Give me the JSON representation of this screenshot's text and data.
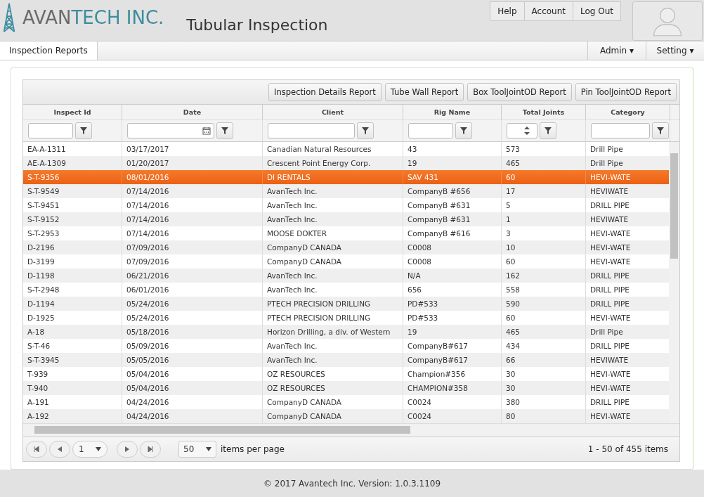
{
  "header": {
    "logo_dark": "AVAN",
    "logo_accent": "TECH INC.",
    "title": "Tubular Inspection",
    "links": [
      "Help",
      "Account",
      "Log Out"
    ]
  },
  "nav": {
    "tabs": [
      {
        "label": "Inspection Reports",
        "selected": true
      }
    ],
    "menus": [
      "Admin ▾",
      "Setting ▾"
    ]
  },
  "toolbar": [
    "Inspection Details Report",
    "Tube Wall Report",
    "Box ToolJointOD Report",
    "Pin ToolJointOD Report"
  ],
  "table": {
    "columns": [
      {
        "label": "Inspect Id",
        "kind": "text"
      },
      {
        "label": "Date",
        "kind": "date"
      },
      {
        "label": "Client",
        "kind": "text"
      },
      {
        "label": "Rig Name",
        "kind": "text"
      },
      {
        "label": "Total Joints",
        "kind": "numeric"
      },
      {
        "label": "Category",
        "kind": "text"
      }
    ],
    "rows": [
      {
        "cells": [
          "EA-A-1311",
          "03/17/2017",
          "Canadian Natural Resources",
          "43",
          "573",
          "Drill Pipe"
        ],
        "selected": false
      },
      {
        "cells": [
          "AE-A-1309",
          "01/20/2017",
          "Crescent Point Energy Corp.",
          "19",
          "465",
          "Drill Pipe"
        ],
        "selected": false
      },
      {
        "cells": [
          "S-T-9356",
          "08/01/2016",
          "DI RENTALS",
          "SAV 431",
          "60",
          "HEVI-WATE"
        ],
        "selected": true
      },
      {
        "cells": [
          "S-T-9549",
          "07/14/2016",
          "AvanTech Inc.",
          "CompanyB #656",
          "17",
          "HEVIWATE"
        ],
        "selected": false
      },
      {
        "cells": [
          "S-T-9451",
          "07/14/2016",
          "AvanTech Inc.",
          "CompanyB #631",
          "5",
          "DRILL PIPE"
        ],
        "selected": false
      },
      {
        "cells": [
          "S-T-9152",
          "07/14/2016",
          "AvanTech Inc.",
          "CompanyB #631",
          "1",
          "HEVIWATE"
        ],
        "selected": false
      },
      {
        "cells": [
          "S-T-2953",
          "07/14/2016",
          "MOOSE DOKTER",
          "CompanyB #616",
          "3",
          "HEVI-WATE"
        ],
        "selected": false
      },
      {
        "cells": [
          "D-2196",
          "07/09/2016",
          "CompanyD CANADA",
          "C0008",
          "10",
          "HEVI-WATE"
        ],
        "selected": false
      },
      {
        "cells": [
          "D-3199",
          "07/09/2016",
          "CompanyD CANADA",
          "C0008",
          "60",
          "HEVI-WATE"
        ],
        "selected": false
      },
      {
        "cells": [
          "D-1198",
          "06/21/2016",
          "AvanTech Inc.",
          "N/A",
          "162",
          "DRILL PIPE"
        ],
        "selected": false
      },
      {
        "cells": [
          "S-T-2948",
          "06/01/2016",
          "AvanTech Inc.",
          "656",
          "558",
          "DRILL PIPE"
        ],
        "selected": false
      },
      {
        "cells": [
          "D-1194",
          "05/24/2016",
          "PTECH PRECISION DRILLING",
          "PD#533",
          "590",
          "DRILL PIPE"
        ],
        "selected": false
      },
      {
        "cells": [
          "D-1925",
          "05/24/2016",
          "PTECH PRECISION DRILLING",
          "PD#533",
          "60",
          "HEVI-WATE"
        ],
        "selected": false
      },
      {
        "cells": [
          "A-18",
          "05/18/2016",
          "Horizon Drilling, a div. of Western",
          "19",
          "465",
          "Drill Pipe"
        ],
        "selected": false
      },
      {
        "cells": [
          "S-T-46",
          "05/09/2016",
          "AvanTech Inc.",
          "CompanyB#617",
          "434",
          "DRILL PIPE"
        ],
        "selected": false
      },
      {
        "cells": [
          "S-T-3945",
          "05/05/2016",
          "AvanTech Inc.",
          "CompanyB#617",
          "66",
          "HEVIWATE"
        ],
        "selected": false
      },
      {
        "cells": [
          "T-939",
          "05/04/2016",
          "OZ RESOURCES",
          "Champion#356",
          "30",
          "HEVI-WATE"
        ],
        "selected": false
      },
      {
        "cells": [
          "T-940",
          "05/04/2016",
          "OZ RESOURCES",
          "CHAMPION#358",
          "30",
          "HEVI-WATE"
        ],
        "selected": false
      },
      {
        "cells": [
          "A-191",
          "04/24/2016",
          "CompanyD CANADA",
          "C0024",
          "380",
          "DRILL PIPE"
        ],
        "selected": false
      },
      {
        "cells": [
          "A-192",
          "04/24/2016",
          "CompanyD CANADA",
          "C0024",
          "80",
          "HEVI-WATE"
        ],
        "selected": false
      }
    ]
  },
  "pager": {
    "page": "1",
    "page_size": "50",
    "page_size_label": "items per page",
    "summary": "1 - 50 of 455 items"
  },
  "footer": "© 2017 Avantech Inc. Version: 1.0.3.1109"
}
